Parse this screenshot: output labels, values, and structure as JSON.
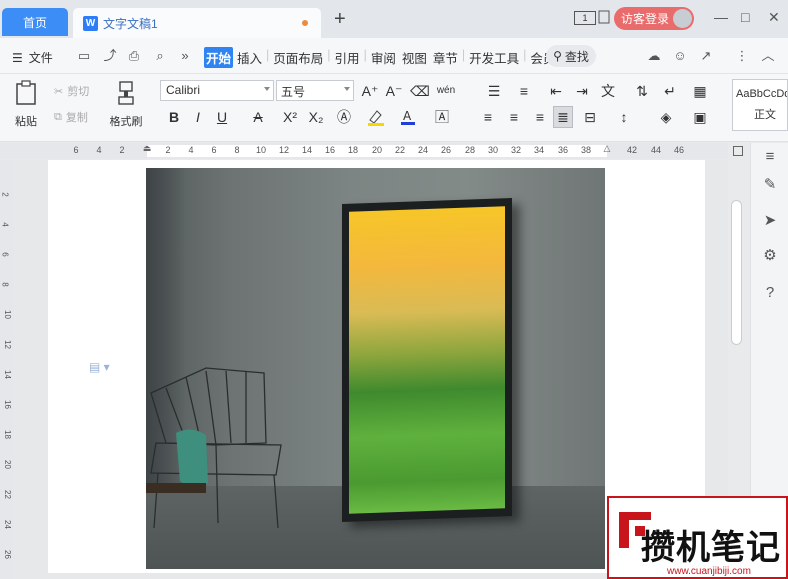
{
  "tabs": {
    "home_label": "首页",
    "doc_icon_letter": "W",
    "doc_title": "文字文稿1",
    "add_symbol": "+"
  },
  "titlebar": {
    "page_badge": "1",
    "login_label": "访客登录",
    "minimize": "—",
    "maximize": "□",
    "close": "✕"
  },
  "menu": {
    "file_label": "文件",
    "more_symbol": "»",
    "tabs": [
      "开始",
      "插入",
      "页面布局",
      "引用",
      "审阅",
      "视图",
      "章节",
      "开发工具",
      "会员专享"
    ],
    "active_tab": "开始",
    "search_label": "查找"
  },
  "ribbon": {
    "paste_label": "粘贴",
    "cut_label": "剪切",
    "copy_label": "复制",
    "format_painter_label": "格式刷",
    "font_name": "Calibri",
    "font_size": "五号",
    "styles_sample": "AaBbCcDd",
    "style_normal": "正文",
    "bold": "B",
    "italic": "I",
    "underline": "U",
    "strike": "A",
    "superscript": "X²",
    "subscript": "X₂",
    "grow": "A⁺",
    "shrink": "A⁻",
    "wen": "wén"
  },
  "ruler": {
    "ticks": [
      "6",
      "4",
      "2",
      "",
      "2",
      "4",
      "6",
      "8",
      "10",
      "12",
      "14",
      "16",
      "18",
      "20",
      "22",
      "24",
      "26",
      "28",
      "30",
      "32",
      "34",
      "36",
      "38",
      "",
      "42",
      "44",
      "46"
    ],
    "vticks": [
      "2",
      "4",
      "6",
      "8",
      "10",
      "12",
      "14",
      "16",
      "18",
      "20",
      "22",
      "24",
      "26"
    ]
  },
  "watermark": {
    "title": "攒机笔记",
    "url": "www.cuanjibiji.com"
  },
  "colors": {
    "accent": "#2f84f2",
    "home_tab": "#3c8df5",
    "login": "#e96b6b",
    "watermark_red": "#c8151b"
  }
}
